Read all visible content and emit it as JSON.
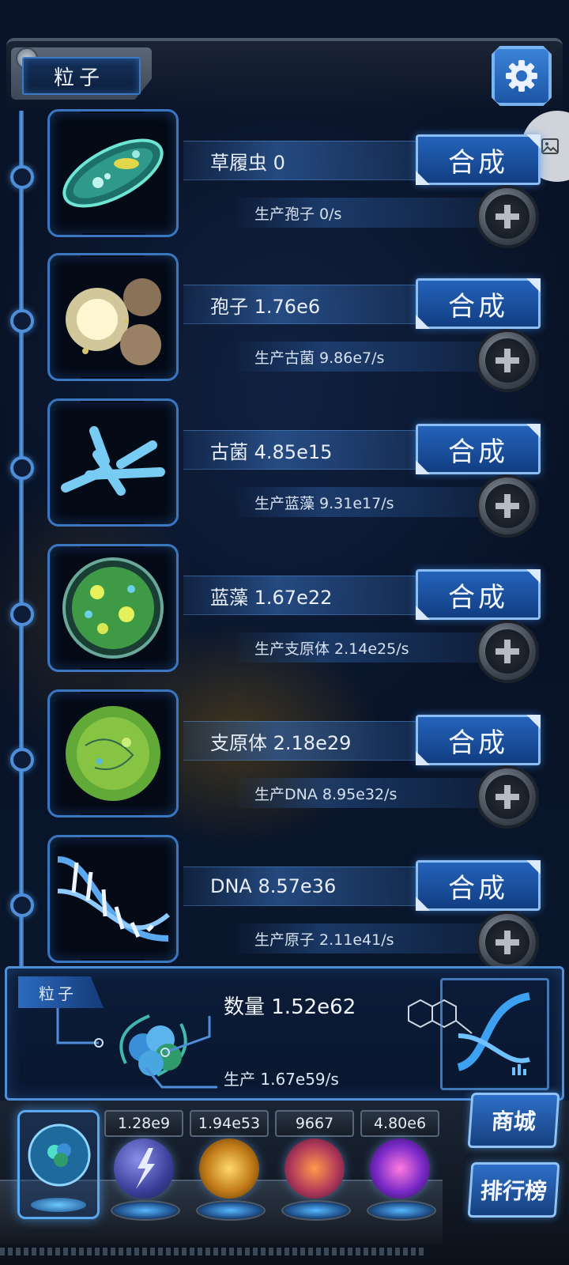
{
  "header": {
    "title": "粒子",
    "settings_icon": "gear-icon"
  },
  "side_bubble": {
    "icon": "image-icon"
  },
  "units": [
    {
      "name": "草履虫 0",
      "synth_label": "合成",
      "production": "生产孢子 0/s",
      "icon": "paramecium-icon"
    },
    {
      "name": "孢子 1.76e6",
      "synth_label": "合成",
      "production": "生产古菌 9.86e7/s",
      "icon": "spore-icon"
    },
    {
      "name": "古菌 4.85e15",
      "synth_label": "合成",
      "production": "生产蓝藻 9.31e17/s",
      "icon": "archaea-icon"
    },
    {
      "name": "蓝藻 1.67e22",
      "synth_label": "合成",
      "production": "生产支原体 2.14e25/s",
      "icon": "cyanobacteria-icon"
    },
    {
      "name": "支原体 2.18e29",
      "synth_label": "合成",
      "production": "生产DNA 8.95e32/s",
      "icon": "mycoplasma-icon"
    },
    {
      "name": "DNA 8.57e36",
      "synth_label": "合成",
      "production": "生产原子 2.11e41/s",
      "icon": "dna-icon"
    }
  ],
  "summary": {
    "tag": "粒子",
    "count": "数量 1.52e62",
    "production": "生产 1.67e59/s",
    "icon": "particle-cluster-icon",
    "deco_icon": "dna-helix-icon"
  },
  "dock": {
    "values": [
      "1.28e9",
      "1.94e53",
      "9667",
      "4.80e6"
    ],
    "orbs": [
      "lightning-orb-icon",
      "fire-orb-icon",
      "brain-orb-icon",
      "vortex-orb-icon"
    ],
    "current_orb": "atom-orb-icon",
    "shop_label": "商城",
    "rank_label": "排行榜"
  },
  "colors": {
    "accent": "#3a76c2",
    "button": "#2463ba",
    "background": "#060d1c"
  }
}
